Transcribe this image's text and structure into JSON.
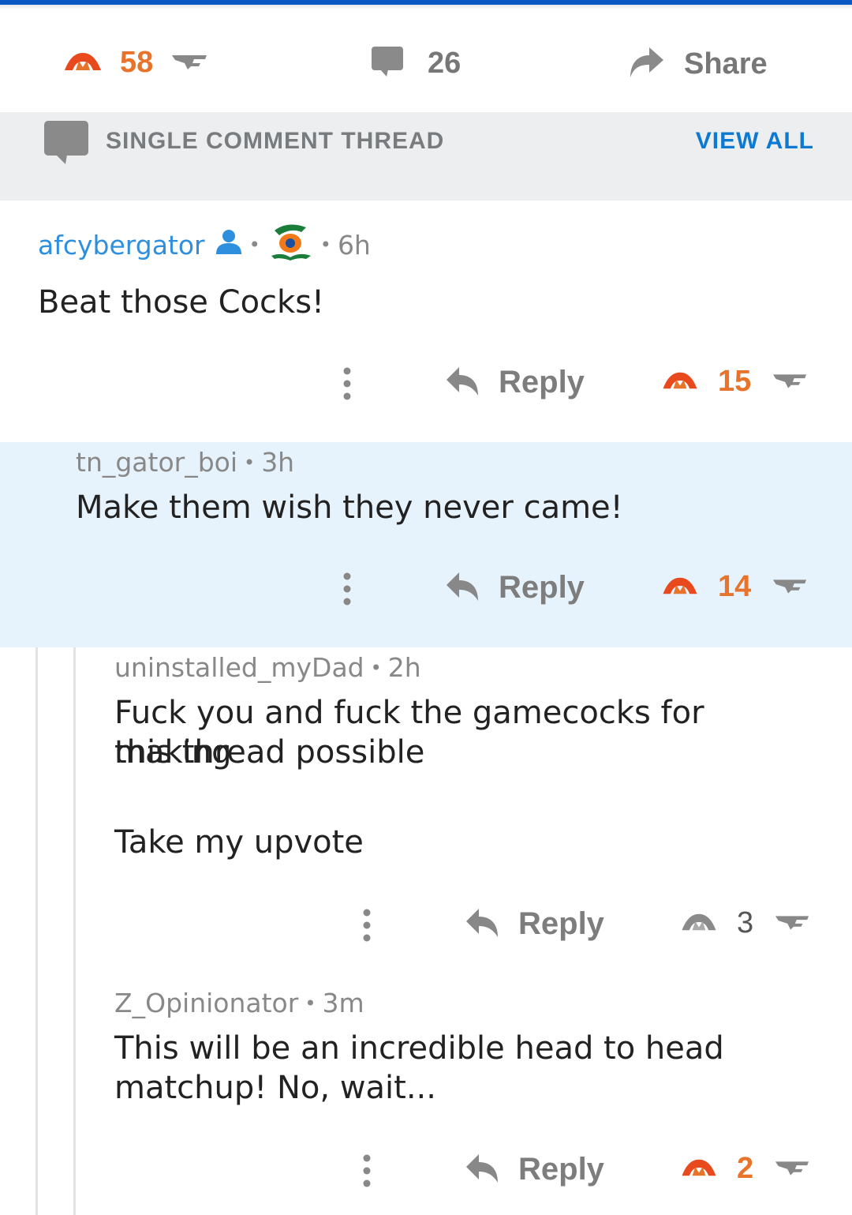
{
  "post": {
    "score": "58",
    "comments": "26",
    "share_label": "Share"
  },
  "thread_banner": {
    "label": "SINGLE COMMENT THREAD",
    "view_all": "VIEW ALL"
  },
  "comments": [
    {
      "author": "afcybergator",
      "time": "6h",
      "text": "Beat those Cocks!",
      "reply_label": "Reply",
      "score": "15"
    },
    {
      "author": "tn_gator_boi",
      "time": "3h",
      "text": "Make them wish they never came!",
      "reply_label": "Reply",
      "score": "14"
    },
    {
      "author": "uninstalled_myDad",
      "time": "2h",
      "text_line1": "Fuck you and fuck the gamecocks for making",
      "text_line2": "this thread possible",
      "text_line3": "Take my upvote",
      "reply_label": "Reply",
      "score": "3"
    },
    {
      "author": "Z_Opinionator",
      "time": "3m",
      "text_line1": "This will be an incredible head to head",
      "text_line2": "matchup! No, wait...",
      "reply_label": "Reply",
      "score": "2"
    }
  ],
  "colors": {
    "accent_orange": "#e8742c",
    "link_blue": "#0d79d1",
    "top_bar": "#0a58c4",
    "highlight_bg": "#e7f3fc"
  }
}
